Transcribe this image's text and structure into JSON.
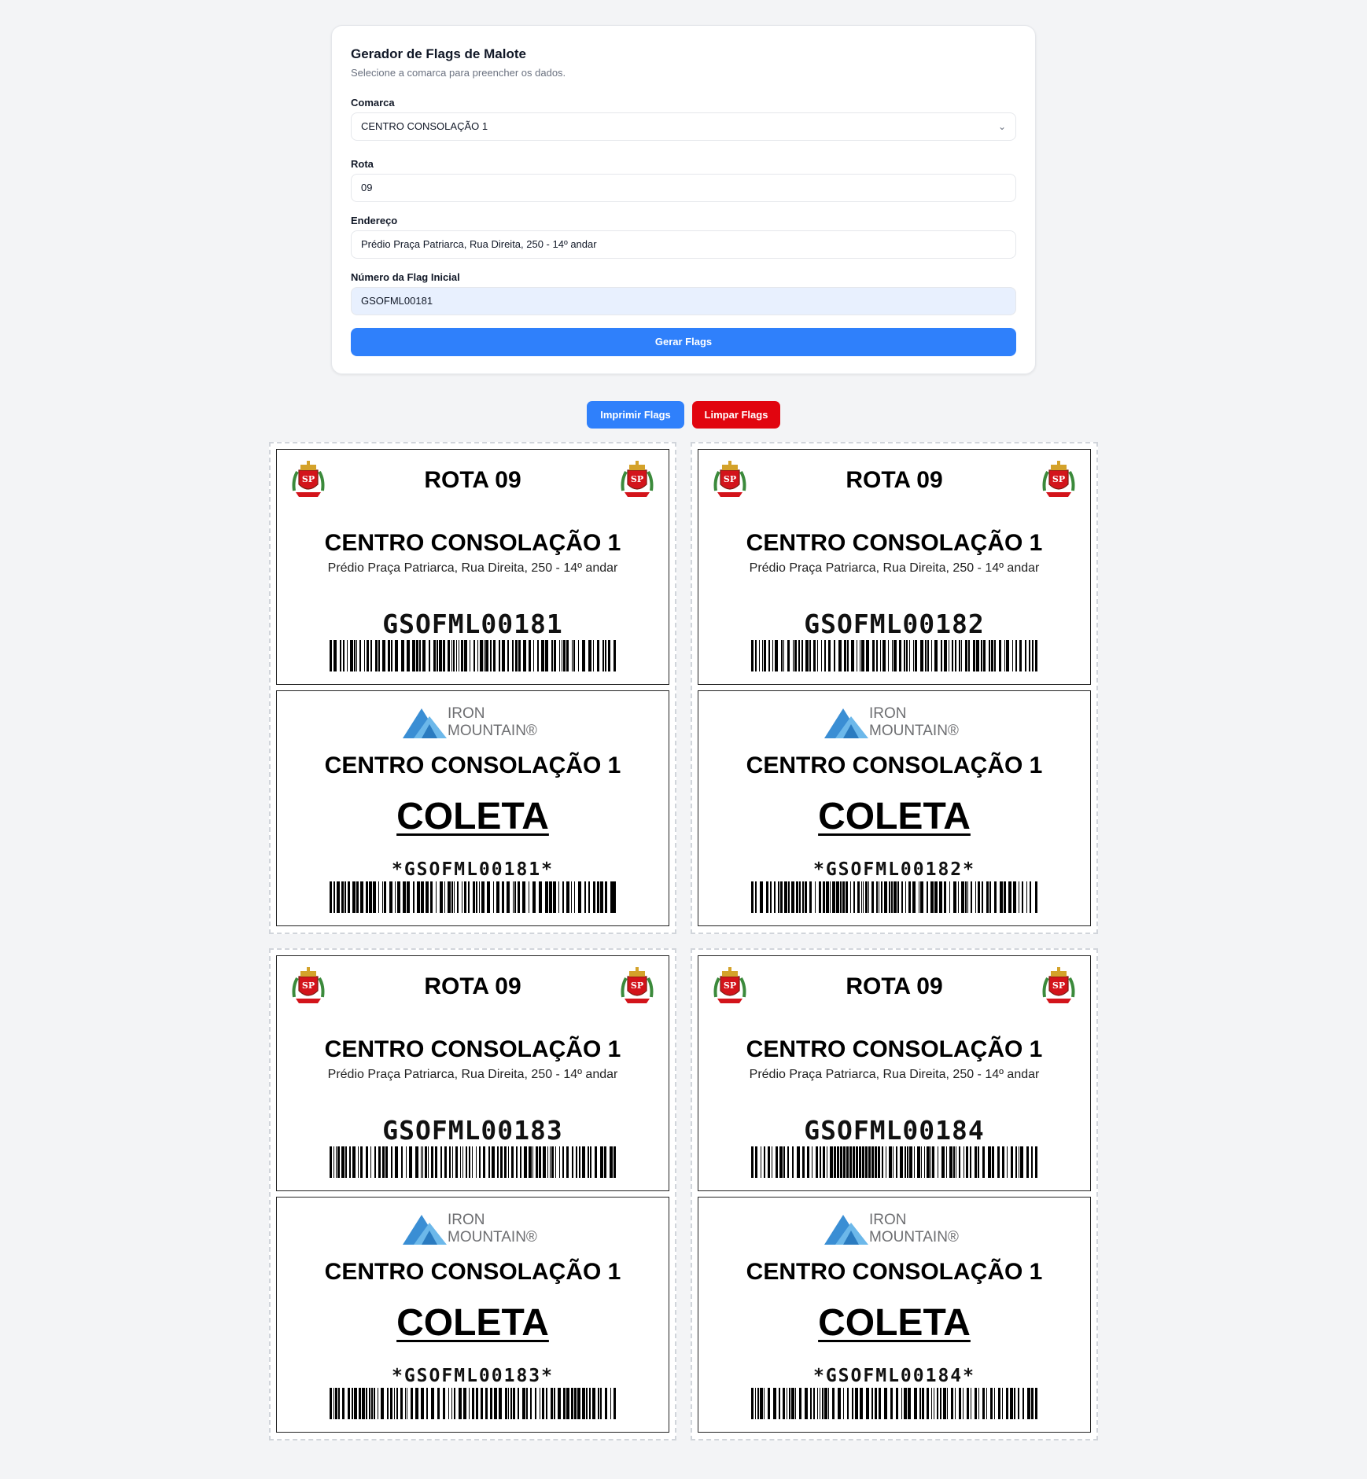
{
  "form": {
    "title": "Gerador de Flags de Malote",
    "subtitle": "Selecione a comarca para preencher os dados.",
    "comarca_label": "Comarca",
    "comarca_value": "CENTRO CONSOLAÇÃO 1",
    "rota_label": "Rota",
    "rota_value": "09",
    "endereco_label": "Endereço",
    "endereco_value": "Prédio Praça Patriarca, Rua Direita, 250 - 14º andar",
    "flag_label": "Número da Flag Inicial",
    "flag_value": "GSOFML00181",
    "generate_label": "Gerar Flags"
  },
  "actions": {
    "print_label": "Imprimir Flags",
    "clear_label": "Limpar Flags"
  },
  "colors": {
    "primary": "#2f80fb",
    "danger": "#e1050f",
    "background": "#f3f4f6"
  },
  "icons": {
    "seal": "sp-state-seal-icon",
    "logo": "iron-mountain-logo",
    "select": "chevron-down-icon"
  },
  "flags": [
    {
      "rota": "ROTA 09",
      "comarca": "CENTRO CONSOLAÇÃO 1",
      "address": "Prédio Praça Patriarca, Rua Direita, 250 - 14º andar",
      "code": "GSOFML00181",
      "logo_line1": "IRON",
      "logo_line2": "MOUNTAIN®",
      "coleta": "COLETA",
      "star_code": "*GSOFML00181*"
    },
    {
      "rota": "ROTA 09",
      "comarca": "CENTRO CONSOLAÇÃO 1",
      "address": "Prédio Praça Patriarca, Rua Direita, 250 - 14º andar",
      "code": "GSOFML00182",
      "logo_line1": "IRON",
      "logo_line2": "MOUNTAIN®",
      "coleta": "COLETA",
      "star_code": "*GSOFML00182*"
    },
    {
      "rota": "ROTA 09",
      "comarca": "CENTRO CONSOLAÇÃO 1",
      "address": "Prédio Praça Patriarca, Rua Direita, 250 - 14º andar",
      "code": "GSOFML00183",
      "logo_line1": "IRON",
      "logo_line2": "MOUNTAIN®",
      "coleta": "COLETA",
      "star_code": "*GSOFML00183*"
    },
    {
      "rota": "ROTA 09",
      "comarca": "CENTRO CONSOLAÇÃO 1",
      "address": "Prédio Praça Patriarca, Rua Direita, 250 - 14º andar",
      "code": "GSOFML00184",
      "logo_line1": "IRON",
      "logo_line2": "MOUNTAIN®",
      "coleta": "COLETA",
      "star_code": "*GSOFML00184*"
    }
  ]
}
